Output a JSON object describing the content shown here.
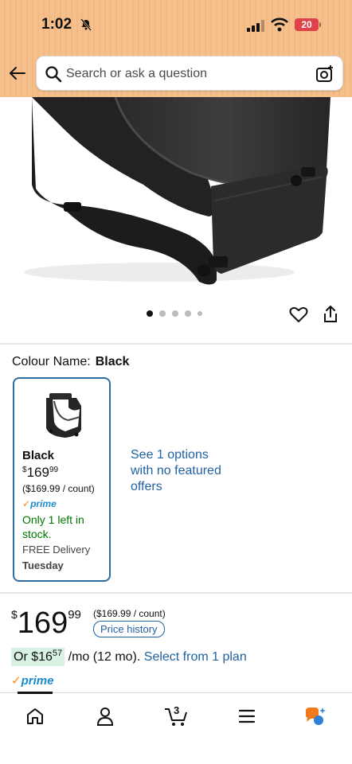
{
  "status_bar": {
    "time": "1:02",
    "battery": "20"
  },
  "search": {
    "placeholder": "Search or ask a question"
  },
  "gallery": {
    "dot_count": 5,
    "active_index": 0
  },
  "variation": {
    "label": "Colour Name:",
    "selected": "Black",
    "card": {
      "name": "Black",
      "price_currency": "$",
      "price_whole": "169",
      "price_fraction": "99",
      "unit_price": "($169.99 / count)",
      "prime": "prime",
      "stock": "Only 1 left in stock.",
      "delivery": "FREE Delivery",
      "delivery_day": "Tuesday"
    },
    "other_options": "See 1 options with no featured offers"
  },
  "price": {
    "currency": "$",
    "whole": "169",
    "fraction": "99",
    "unit_price": "($169.99 / count)",
    "history_button": "Price history"
  },
  "monthly": {
    "prefix": "Or $",
    "whole": "16",
    "fraction": "57",
    "suffix": "/mo (12 mo).",
    "link": "Select from 1 plan"
  },
  "prime_badge": "prime",
  "bottom_nav": {
    "cart_count": "3"
  },
  "colors": {
    "header": "#f6c08c",
    "link": "#2162a1",
    "prime": "#1c8bd0",
    "stock": "#007600",
    "accent": "#e0424c"
  }
}
